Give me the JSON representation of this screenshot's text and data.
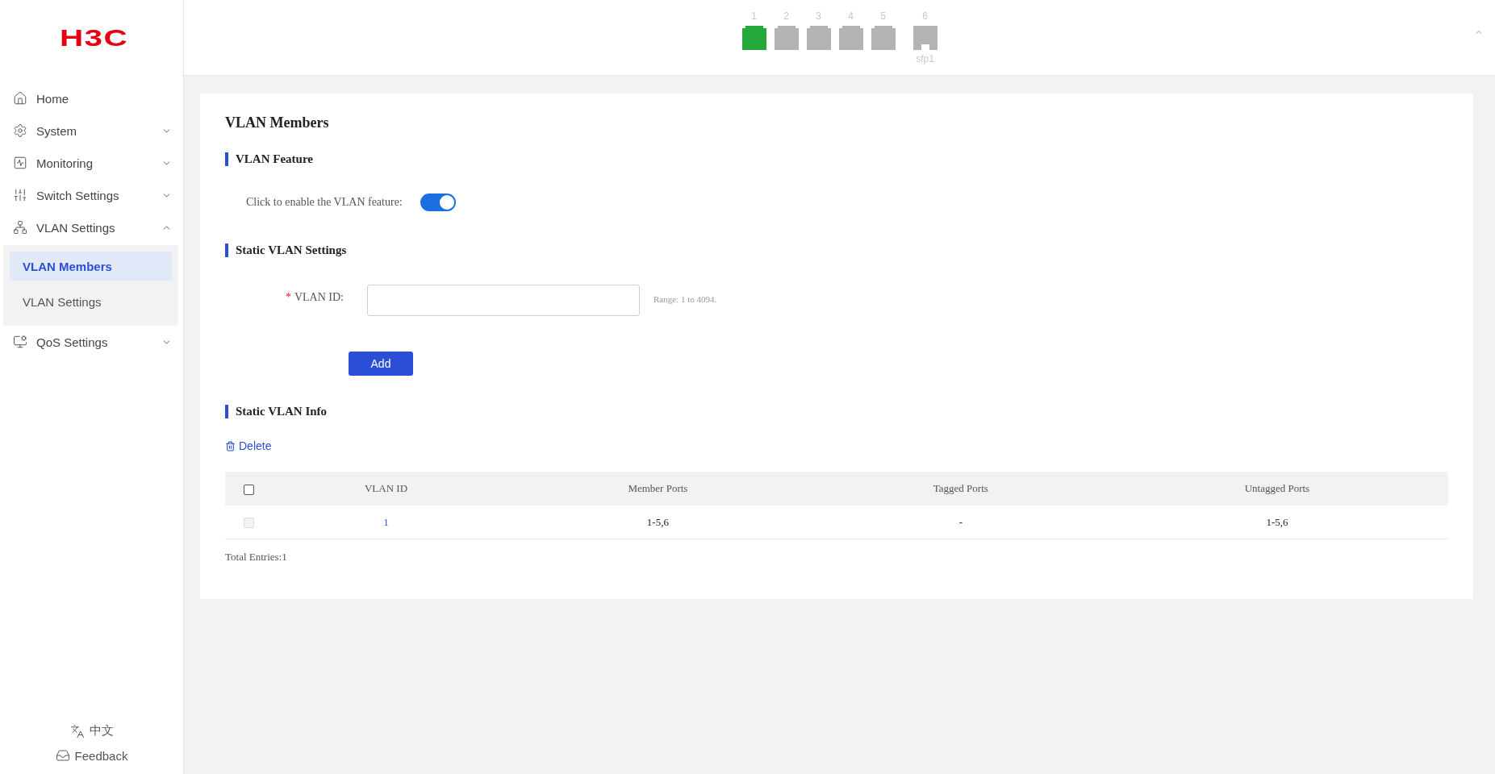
{
  "logo": "H3C",
  "ports": [
    {
      "number": "1",
      "kind": "rj45",
      "linked": true
    },
    {
      "number": "2",
      "kind": "rj45",
      "linked": false
    },
    {
      "number": "3",
      "kind": "rj45",
      "linked": false
    },
    {
      "number": "4",
      "kind": "rj45",
      "linked": false
    },
    {
      "number": "5",
      "kind": "rj45",
      "linked": false
    },
    {
      "number": "6",
      "kind": "sfp",
      "linked": false,
      "caption": "sfp1"
    }
  ],
  "sidebar": {
    "items": [
      {
        "label": "Home",
        "kind": "link"
      },
      {
        "label": "System",
        "kind": "group",
        "expanded": false
      },
      {
        "label": "Monitoring",
        "kind": "group",
        "expanded": false
      },
      {
        "label": "Switch Settings",
        "kind": "group",
        "expanded": false
      },
      {
        "label": "VLAN Settings",
        "kind": "group",
        "expanded": true,
        "children": [
          {
            "label": "VLAN Members",
            "selected": true
          },
          {
            "label": "VLAN Settings",
            "selected": false
          }
        ]
      },
      {
        "label": "QoS Settings",
        "kind": "group",
        "expanded": false
      }
    ],
    "language": "中文",
    "feedback": "Feedback"
  },
  "page": {
    "title": "VLAN Members",
    "feature": {
      "heading": "VLAN Feature",
      "label": "Click to enable the VLAN feature:",
      "on": true
    },
    "static_settings": {
      "heading": "Static VLAN Settings",
      "required_mark": "*",
      "label": "VLAN ID:",
      "hint": "Range: 1 to 4094.",
      "add_button": "Add"
    },
    "info": {
      "heading": "Static VLAN Info",
      "delete_button": "Delete",
      "table": {
        "select_all_checked": false,
        "columns": [
          "VLAN ID",
          "Member Ports",
          "Tagged Ports",
          "Untagged Ports"
        ],
        "rows": [
          {
            "checked": false,
            "disabled": true,
            "cells": [
              "1",
              "1-5,6",
              "-",
              "1-5,6"
            ]
          }
        ]
      },
      "total": "Total Entries:1"
    }
  }
}
